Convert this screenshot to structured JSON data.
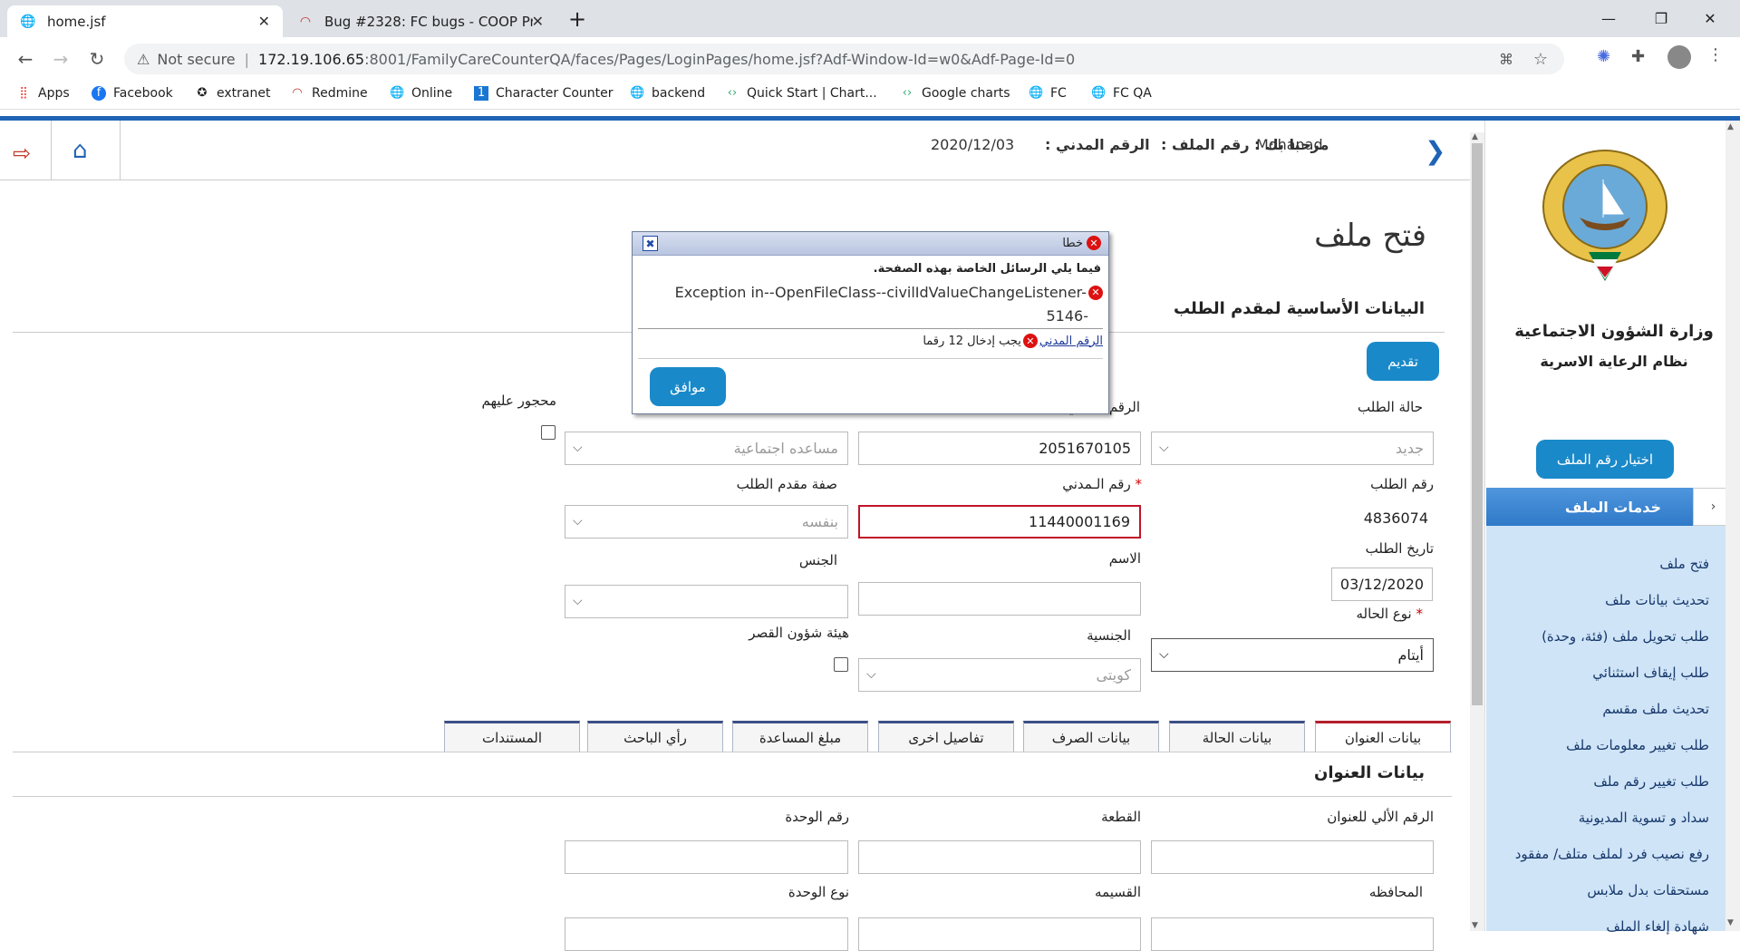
{
  "browser": {
    "tabs": [
      {
        "title": "home.jsf",
        "active": true
      },
      {
        "title": "Bug #2328: FC bugs - COOP Proj",
        "active": false
      }
    ],
    "new_tab": "+",
    "security_label": "Not secure",
    "url_host": "172.19.106.65",
    "url_rest": ":8001/FamilyCareCounterQA/faces/Pages/LoginPages/home.jsf?Adf-Window-Id=w0&Adf-Page-Id=0",
    "bookmarks": [
      "Apps",
      "Facebook",
      "extranet",
      "Redmine",
      "Online",
      "Character Counter",
      "backend",
      "Quick Start | Chart...",
      "Google charts",
      "FC",
      "FC QA"
    ]
  },
  "header": {
    "welcome_label": "مرحبا بك :",
    "user_name": "Mohanad",
    "file_no_label": "رقم الملف :",
    "civil_id_label": "الرقم المدني :",
    "date": "2020/12/03"
  },
  "sidebar": {
    "ministry": "وزارة الشؤون الاجتماعية",
    "system": "نظام الرعاية الاسرية",
    "choose_file_button": "اختيار رقم الملف",
    "services_title": "خدمات الملف",
    "items": [
      "فتح ملف",
      "تحديث بيانات ملف",
      "طلب تحويل ملف (فئة، وحدة)",
      "طلب إيقاف استثنائي",
      "تحديث ملف مقسم",
      "طلب تغيير معلومات ملف",
      "طلب تغيير رقم ملف",
      "سداد و تسوية المديونية",
      "رفع نصيب فرد لملف متلف/ مفقود",
      "مستحقات بدل ملابس",
      "شهادة إلغاء الملف"
    ]
  },
  "page": {
    "title": "فتح ملف",
    "section_title": "البيانات الأساسية لمقدم الطلب",
    "submit_button": "تقديم",
    "request_status_label": "حالة الطلب",
    "request_status_value": "جديد",
    "civil_no_label": "الرقم المدني",
    "civil_no_value": "2051670105",
    "aid_type_value": "مساعده اجتماعية",
    "interdicted_label": "محجور عليهم",
    "request_no_label": "رقم الطلب",
    "request_no_value": "4836074",
    "applicant_civil_label": "رقم الـمدني",
    "applicant_civil_value": "11440001169",
    "applicant_capacity_label": "صفة مقدم الطلب",
    "applicant_capacity_value": "بنفسه",
    "request_date_label": "تاريخ الطلب",
    "request_date_value": "03/12/2020",
    "name_label": "الاسم",
    "gender_label": "الجنس",
    "case_type_label": "نوع الحاله",
    "case_type_value": "أيتام",
    "nationality_label": "الجنسية",
    "nationality_value": "كويتى",
    "minors_label": "هيئة شؤون القصر",
    "required_mark": "*"
  },
  "tabs": [
    "بيانات العنوان",
    "بيانات الحالة",
    "بيانات الصرف",
    "تفاصيل اخرى",
    "مبلغ المساعدة",
    "رأي الباحث",
    "المستندات"
  ],
  "address": {
    "title": "بيانات العنوان",
    "auto_no_label": "الرقم الألي للعنوان",
    "block_label": "القطعة",
    "unit_no_label": "رقم الوحدة",
    "governorate_label": "المحافظه",
    "division_label": "القسيمه",
    "unit_type_label": "نوع الوحدة"
  },
  "dialog": {
    "title": "خطا",
    "intro": "فيما يلي الرسائل الخاصة بهذه الصفحة.",
    "exception_line1": "Exception in--OpenFileClass--civilIdValueChangeListener-",
    "exception_line2": "5146-",
    "field_link": "الرقم المدني",
    "field_message": "يجب إدخال 12 رقما",
    "ok_button": "موافق",
    "close": "✖"
  }
}
